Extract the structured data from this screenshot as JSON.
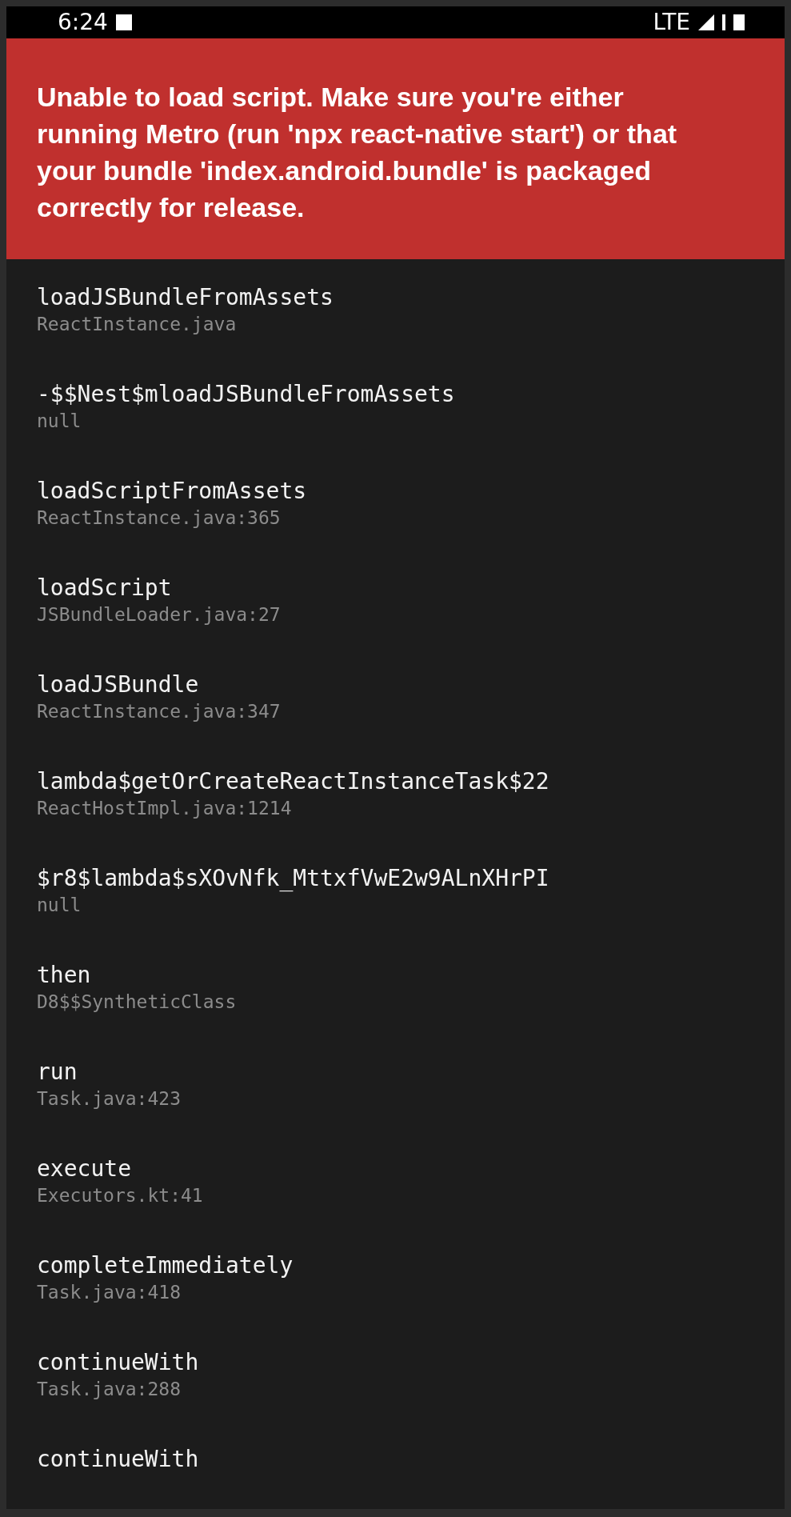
{
  "status_bar": {
    "time": "6:24",
    "network": "LTE"
  },
  "error_banner": {
    "message": "Unable to load script. Make sure you're either running Metro (run 'npx react-native start') or that your bundle 'index.android.bundle' is packaged correctly for release."
  },
  "stack_frames": [
    {
      "method": "loadJSBundleFromAssets",
      "file": "ReactInstance.java"
    },
    {
      "method": "-$$Nest$mloadJSBundleFromAssets",
      "file": "null"
    },
    {
      "method": "loadScriptFromAssets",
      "file": "ReactInstance.java:365"
    },
    {
      "method": "loadScript",
      "file": "JSBundleLoader.java:27"
    },
    {
      "method": "loadJSBundle",
      "file": "ReactInstance.java:347"
    },
    {
      "method": "lambda$getOrCreateReactInstanceTask$22",
      "file": "ReactHostImpl.java:1214"
    },
    {
      "method": "$r8$lambda$sXOvNfk_MttxfVwE2w9ALnXHrPI",
      "file": "null"
    },
    {
      "method": "then",
      "file": "D8$$SyntheticClass"
    },
    {
      "method": "run",
      "file": "Task.java:423"
    },
    {
      "method": "execute",
      "file": "Executors.kt:41"
    },
    {
      "method": "completeImmediately",
      "file": "Task.java:418"
    },
    {
      "method": "continueWith",
      "file": "Task.java:288"
    },
    {
      "method": "continueWith"
    }
  ]
}
